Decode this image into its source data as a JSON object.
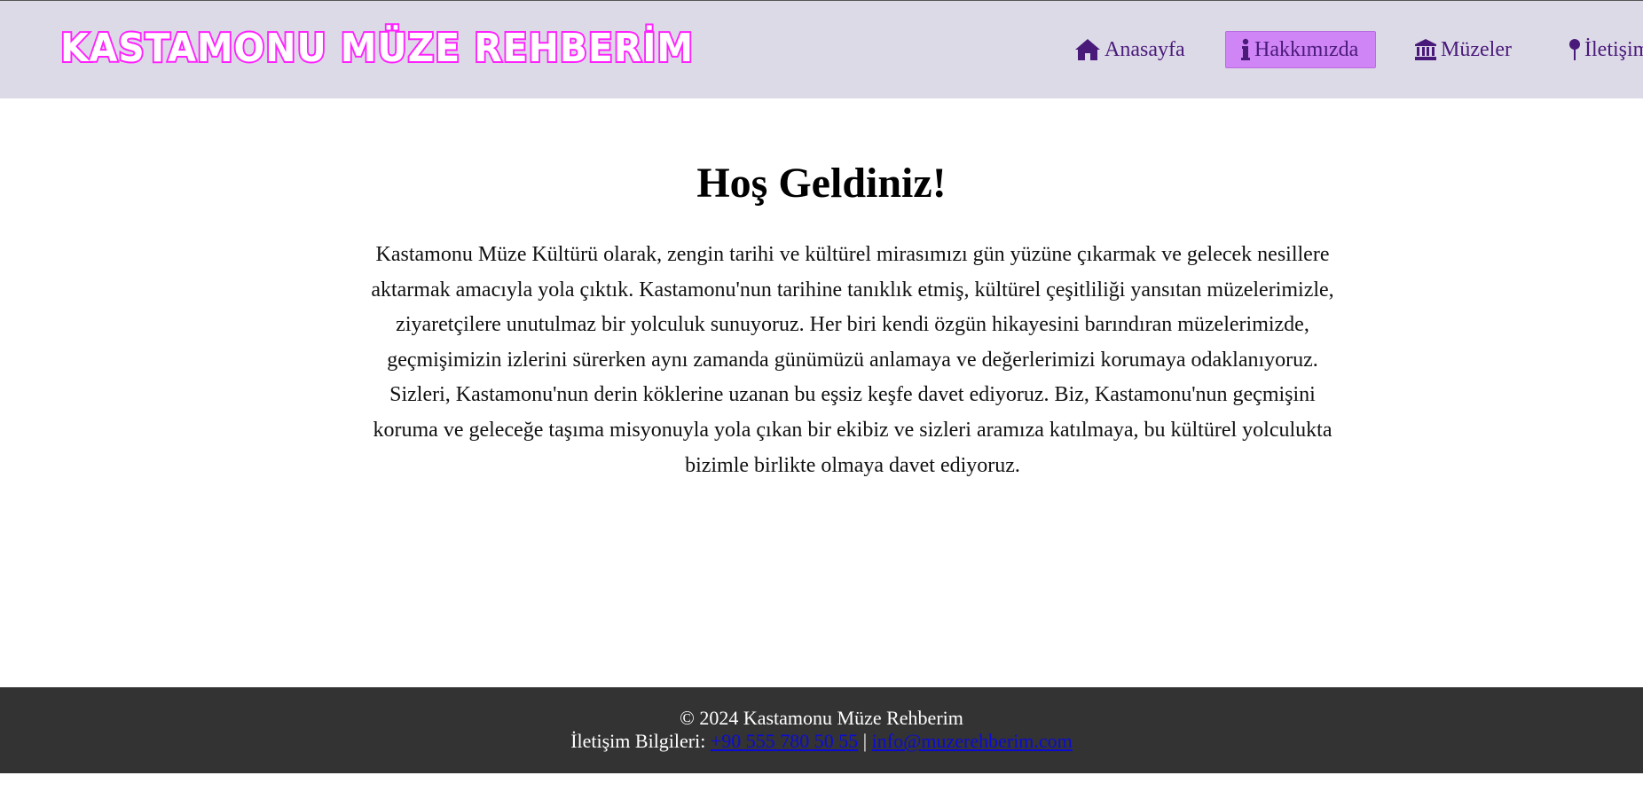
{
  "header": {
    "logo": "KASTAMONU MÜZE REHBERİM",
    "nav": [
      {
        "label": "Anasayfa",
        "icon": "home-icon",
        "active": false
      },
      {
        "label": "Hakkımızda",
        "icon": "info-icon",
        "active": true
      },
      {
        "label": "Müzeler",
        "icon": "museum-icon",
        "active": false
      },
      {
        "label": "İletişim",
        "icon": "map-pin-icon",
        "active": false
      }
    ]
  },
  "main": {
    "title": "Hoş Geldiniz!",
    "intro": "Kastamonu Müze Kültürü olarak, zengin tarihi ve kültürel mirasımızı gün yüzüne çıkarmak ve gelecek nesillere aktarmak amacıyla yola çıktık. Kastamonu'nun tarihine tanıklık etmiş, kültürel çeşitliliği yansıtan müzelerimizle, ziyaretçilere unutulmaz bir yolculuk sunuyoruz. Her biri kendi özgün hikayesini barındıran müzelerimizde, geçmişimizin izlerini sürerken aynı zamanda günümüzü anlamaya ve değerlerimizi korumaya odaklanıyoruz. Sizleri, Kastamonu'nun derin köklerine uzanan bu eşsiz keşfe davet ediyoruz. Biz, Kastamonu'nun geçmişini koruma ve geleceğe taşıma misyonuyla yola çıkan bir ekibiz ve sizleri aramıza katılmaya, bu kültürel yolculukta bizimle birlikte olmaya davet ediyoruz."
  },
  "footer": {
    "copyright": "© 2024 Kastamonu Müze Rehberim",
    "contact_label": "İletişim Bilgileri:",
    "phone": "+90 555 780 50 55",
    "separator": "|",
    "email": "info@muzerehberim.com"
  },
  "colors": {
    "header_bg": "#dddae8",
    "logo_stroke": "#ff22ff",
    "nav_text": "#4a1a7a",
    "nav_active_bg": "#cf85f5",
    "footer_bg": "#333333",
    "link": "#0b0bd6"
  }
}
